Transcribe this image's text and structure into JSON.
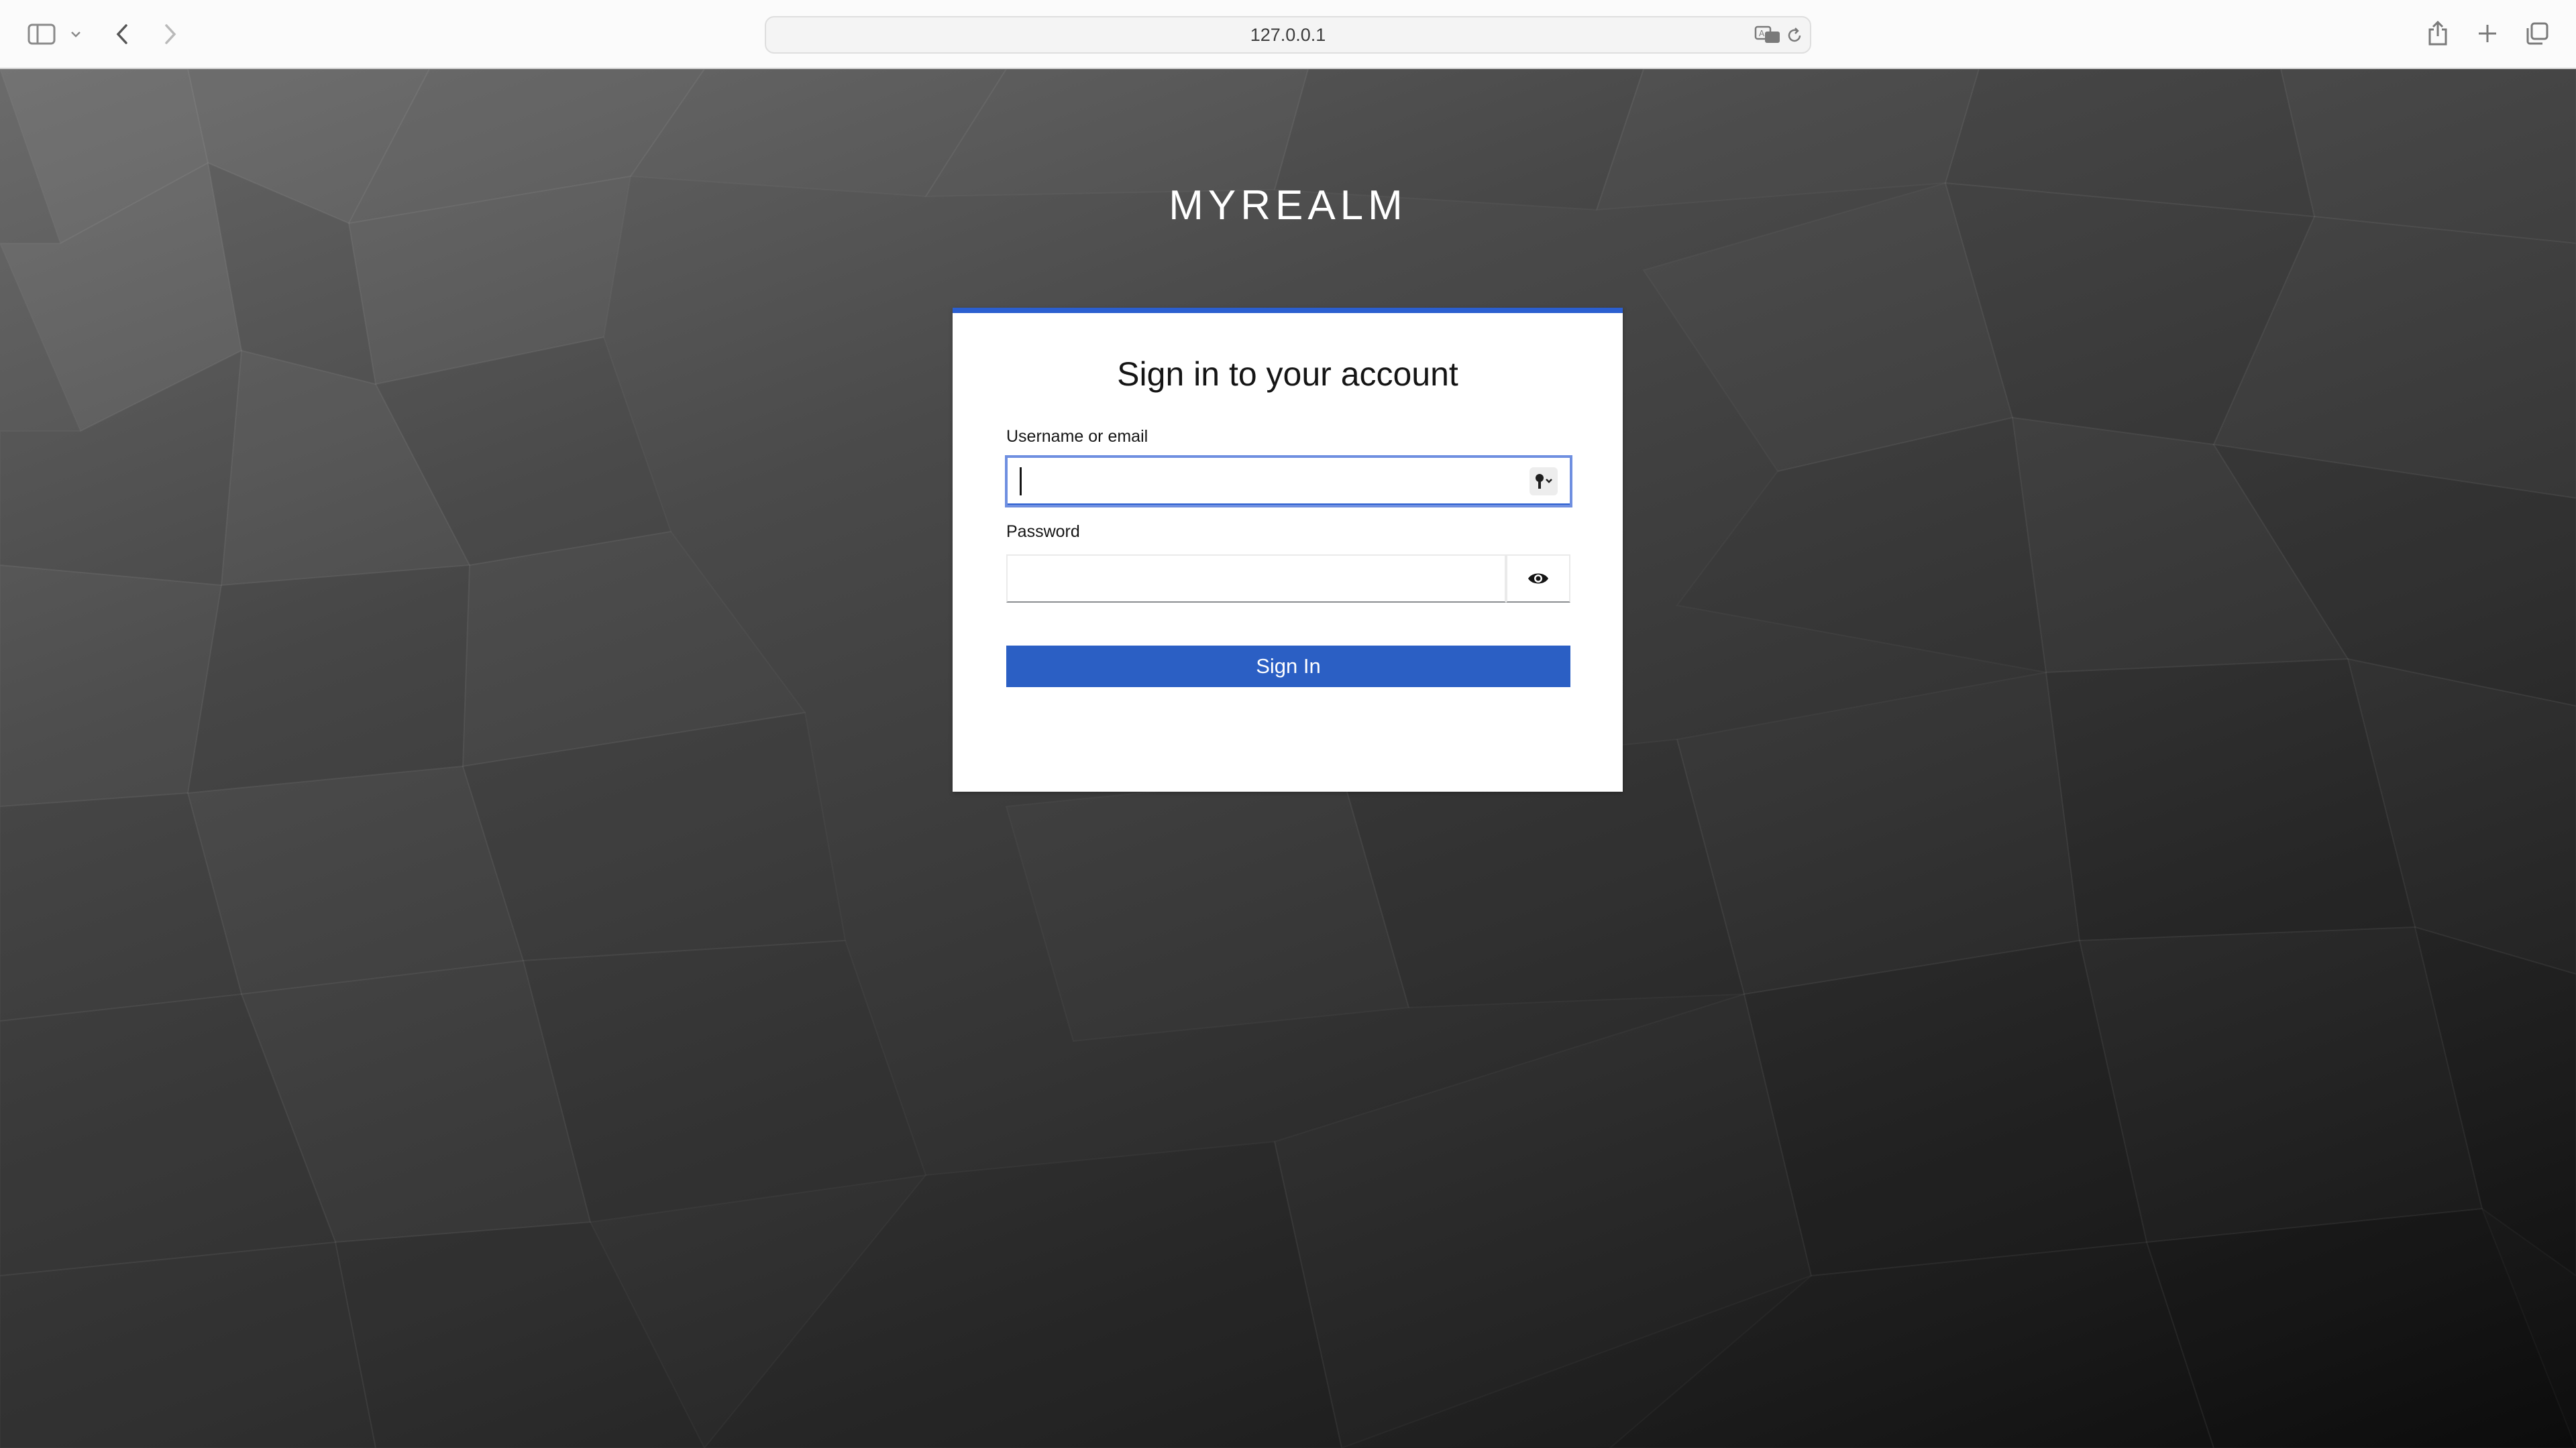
{
  "browser": {
    "url": "127.0.0.1",
    "icons": {
      "sidebar": "sidebar-icon",
      "back": "chevron-left-icon",
      "forward": "chevron-right-icon",
      "translate": "translate-icon",
      "reload": "reload-icon",
      "share": "share-icon",
      "new_tab": "plus-icon",
      "tabs": "tabs-overview-icon"
    }
  },
  "login": {
    "realm_title": "MYREALM",
    "heading": "Sign in to your account",
    "username_label": "Username or email",
    "username_value": "",
    "password_label": "Password",
    "password_value": "",
    "submit_label": "Sign In",
    "accent_color": "#2b5fc4",
    "icons": {
      "password_manager": "key-icon",
      "show_password": "eye-icon"
    }
  }
}
